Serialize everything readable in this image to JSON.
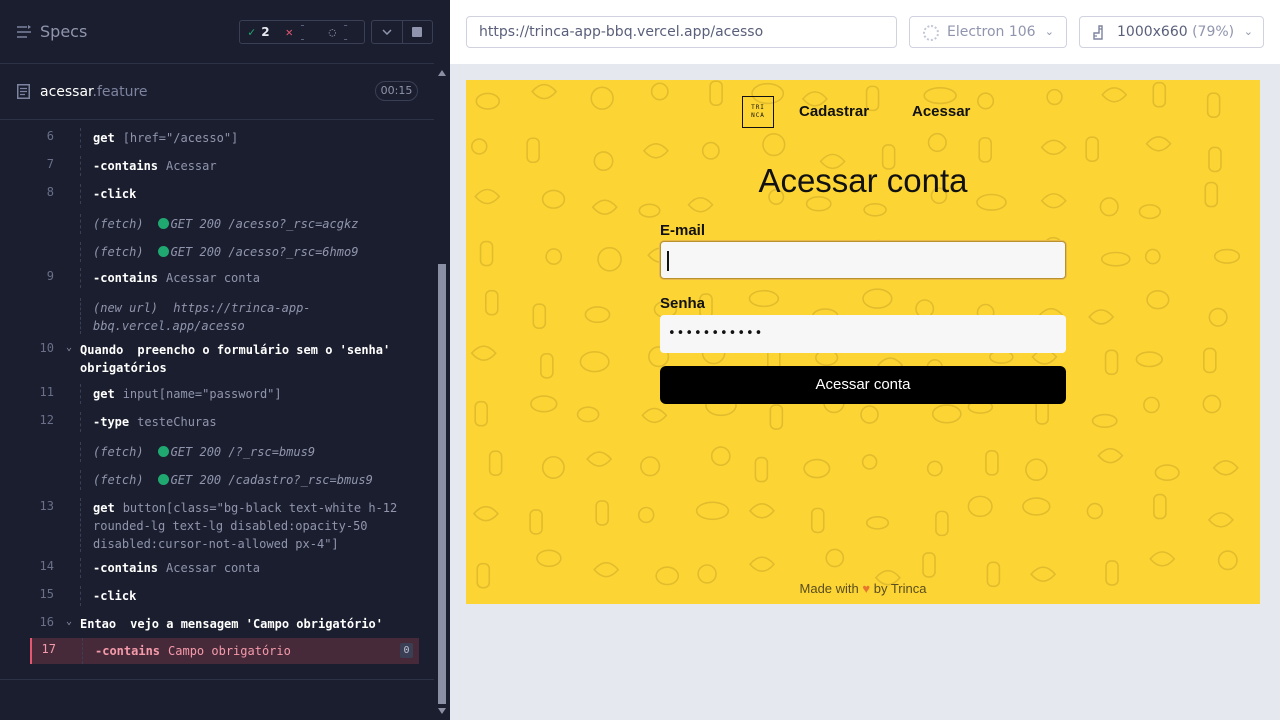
{
  "reporter": {
    "title": "Specs",
    "stats": {
      "passed": "2",
      "failed": "--",
      "pending": "--"
    },
    "file": {
      "name": "acessar",
      "ext": ".feature",
      "duration": "00:15"
    },
    "commands": [
      {
        "line": "6",
        "kind": "cmd",
        "keyword": "get",
        "arg": "[href=\"/acesso\"]"
      },
      {
        "line": "7",
        "kind": "cmd",
        "keyword": "-contains",
        "arg": "Acessar"
      },
      {
        "line": "8",
        "kind": "cmd",
        "keyword": "-click",
        "arg": ""
      },
      {
        "line": "",
        "kind": "fetch",
        "label": "(fetch)",
        "detail": "GET 200 /acesso?_rsc=acgkz"
      },
      {
        "line": "",
        "kind": "fetch",
        "label": "(fetch)",
        "detail": "GET 200 /acesso?_rsc=6hmo9"
      },
      {
        "line": "9",
        "kind": "cmd",
        "keyword": "-contains",
        "arg": "Acessar conta"
      },
      {
        "line": "",
        "kind": "newurl",
        "label": "(new url)",
        "detail": "https://trinca-app-",
        "detail2": "bbq.vercel.app/acesso"
      },
      {
        "line": "10",
        "kind": "step",
        "keyword": "Quando",
        "desc": "preencho o formulário sem o 'senha'",
        "desc2": "obrigatórios"
      },
      {
        "line": "11",
        "kind": "cmd",
        "keyword": "get",
        "arg": "input[name=\"password\"]"
      },
      {
        "line": "12",
        "kind": "cmd",
        "keyword": "-type",
        "arg": "testeChuras"
      },
      {
        "line": "",
        "kind": "fetch",
        "label": "(fetch)",
        "detail": "GET 200 /?_rsc=bmus9"
      },
      {
        "line": "",
        "kind": "fetch",
        "label": "(fetch)",
        "detail": "GET 200 /cadastro?_rsc=bmus9"
      },
      {
        "line": "13",
        "kind": "cmd3",
        "keyword": "get",
        "arg": "button[class=\"bg-black text-white h-12",
        "arg2": "rounded-lg text-lg disabled:opacity-50",
        "arg3": "disabled:cursor-not-allowed px-4\"]"
      },
      {
        "line": "14",
        "kind": "cmd",
        "keyword": "-contains",
        "arg": "Acessar conta"
      },
      {
        "line": "15",
        "kind": "cmd",
        "keyword": "-click",
        "arg": ""
      },
      {
        "line": "16",
        "kind": "step",
        "keyword": "Entao",
        "desc": "vejo a mensagem 'Campo obrigatório'",
        "desc2": ""
      },
      {
        "line": "17",
        "kind": "error",
        "keyword": "-contains",
        "arg": "Campo obrigatório",
        "badge": "0"
      }
    ]
  },
  "toolbar": {
    "url": "https://trinca-app-bbq.vercel.app/acesso",
    "browser": "Electron 106",
    "viewport": "1000x660",
    "viewport_pct": "(79%)"
  },
  "app": {
    "logo_text": "TRINCA",
    "nav": {
      "cadastrar": "Cadastrar",
      "acessar": "Acessar"
    },
    "heading": "Acessar conta",
    "email_label": "E-mail",
    "email_value": "",
    "senha_label": "Senha",
    "password_value": "•••••••••••",
    "submit_label": "Acessar conta",
    "footer_pre": "Made with",
    "footer_post": "by Trinca"
  },
  "colors": {
    "accent_yellow": "#fcd535",
    "pass_green": "#1fa971",
    "fail_red": "#e45770"
  }
}
